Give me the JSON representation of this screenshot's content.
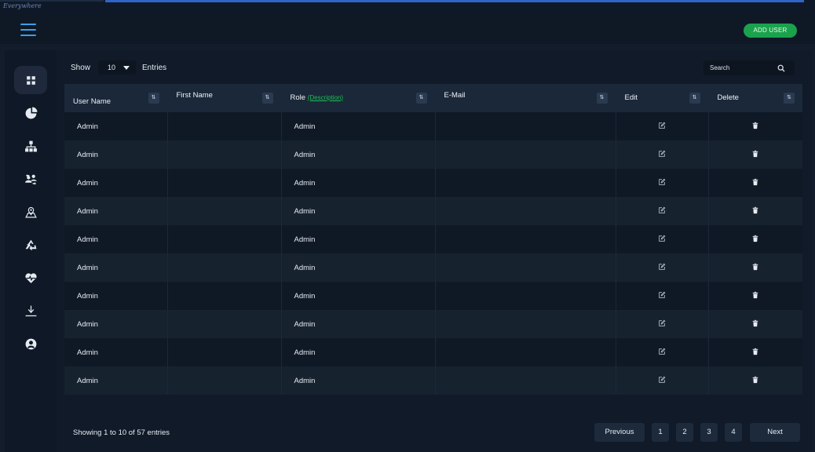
{
  "app": {
    "logo_text": "Everywhere",
    "accent_color": "#2f64c8",
    "brand_green": "#1aa24d"
  },
  "header": {
    "menu_icon": "hamburger-icon",
    "add_user_label": "ADD USER"
  },
  "sidebar": {
    "items": [
      {
        "icon": "dashboard-icon",
        "active": true
      },
      {
        "icon": "pie-chart-icon",
        "active": false
      },
      {
        "icon": "hierarchy-icon",
        "active": false
      },
      {
        "icon": "user-sync-icon",
        "active": false
      },
      {
        "icon": "map-pin-icon",
        "active": false
      },
      {
        "icon": "recycle-icon",
        "active": false
      },
      {
        "icon": "heart-pulse-icon",
        "active": false
      },
      {
        "icon": "download-icon",
        "active": false
      },
      {
        "icon": "user-circle-icon",
        "active": false
      }
    ]
  },
  "controls": {
    "show_label": "Show",
    "entries_value": "10",
    "entries_label": "Entries",
    "search_placeholder": "Search"
  },
  "table": {
    "columns": [
      {
        "label": "User Name"
      },
      {
        "label": "First Name"
      },
      {
        "label": "Role",
        "link": "(Description)"
      },
      {
        "label": "E-Mail"
      },
      {
        "label": "Edit"
      },
      {
        "label": "Delete"
      }
    ],
    "sort_glyph": "⇅",
    "rows": [
      {
        "user_name": "Admin",
        "first_name": "",
        "role": "Admin",
        "email": ""
      },
      {
        "user_name": "Admin",
        "first_name": "",
        "role": "Admin",
        "email": ""
      },
      {
        "user_name": "Admin",
        "first_name": "",
        "role": "Admin",
        "email": ""
      },
      {
        "user_name": "Admin",
        "first_name": "",
        "role": "Admin",
        "email": ""
      },
      {
        "user_name": "Admin",
        "first_name": "",
        "role": "Admin",
        "email": ""
      },
      {
        "user_name": "Admin",
        "first_name": "",
        "role": "Admin",
        "email": ""
      },
      {
        "user_name": "Admin",
        "first_name": "",
        "role": "Admin",
        "email": ""
      },
      {
        "user_name": "Admin",
        "first_name": "",
        "role": "Admin",
        "email": ""
      },
      {
        "user_name": "Admin",
        "first_name": "",
        "role": "Admin",
        "email": ""
      },
      {
        "user_name": "Admin",
        "first_name": "",
        "role": "Admin",
        "email": ""
      }
    ]
  },
  "footer": {
    "info": "Showing 1 to 10 of 57 entries",
    "previous_label": "Previous",
    "pages": [
      "1",
      "2",
      "3",
      "4"
    ],
    "next_label": "Next"
  }
}
